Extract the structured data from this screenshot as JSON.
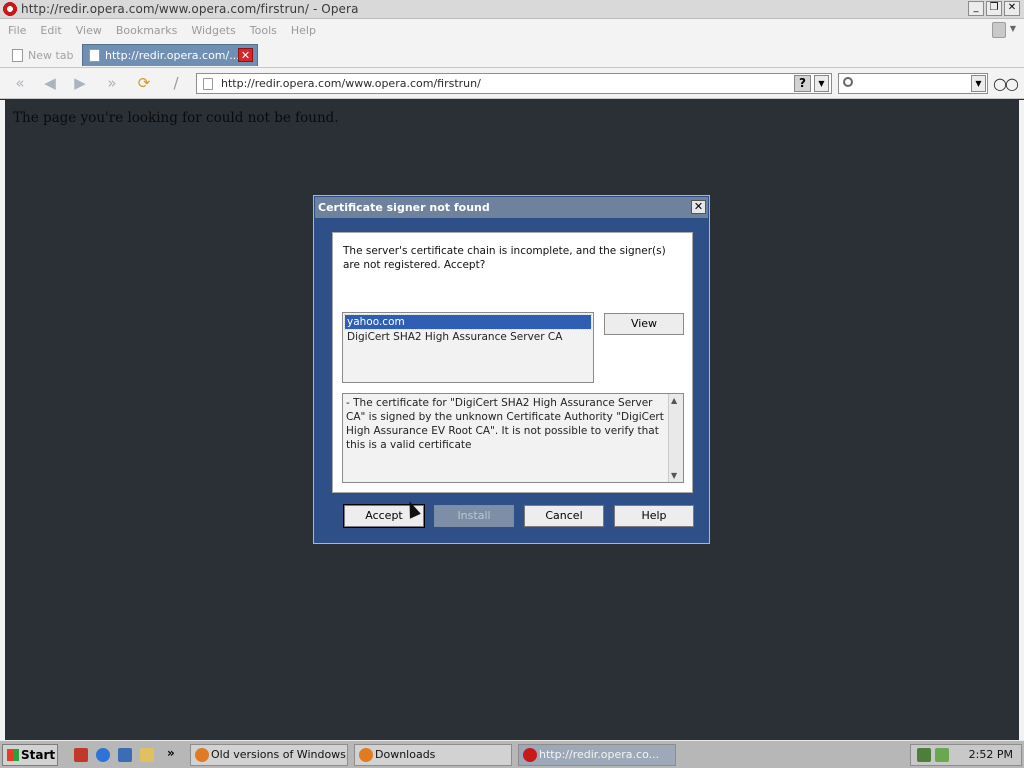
{
  "window": {
    "title": "http://redir.opera.com/www.opera.com/firstrun/ - Opera",
    "min": "_",
    "max": "❐",
    "close": "✕"
  },
  "menu": [
    "File",
    "Edit",
    "View",
    "Bookmarks",
    "Widgets",
    "Tools",
    "Help"
  ],
  "tabs": [
    {
      "label": "New tab"
    },
    {
      "label": "http://redir.opera.com/..."
    }
  ],
  "address_bar": {
    "url": "http://redir.opera.com/www.opera.com/firstrun/",
    "help": "?"
  },
  "page": {
    "message": "The page you're looking for could not be found."
  },
  "dialog": {
    "title": "Certificate signer not found",
    "close": "✕",
    "message": "The server's certificate chain is incomplete, and the signer(s) are not registered. Accept?",
    "certificates": [
      "yahoo.com",
      "DigiCert SHA2 High Assurance Server CA"
    ],
    "view_label": "View",
    "details": "- The certificate for \"DigiCert SHA2 High Assurance Server CA\" is signed by the unknown Certificate Authority \"DigiCert High Assurance EV Root CA\". It is not possible to verify that this is a valid certificate",
    "buttons": {
      "accept": "Accept",
      "install": "Install",
      "cancel": "Cancel",
      "help": "Help"
    }
  },
  "taskbar": {
    "start": "Start",
    "chevron": "»",
    "tasks": [
      {
        "label": "Old versions of Windows,..."
      },
      {
        "label": "Downloads"
      },
      {
        "label": "http://redir.opera.co..."
      }
    ],
    "clock": "2:52 PM"
  }
}
